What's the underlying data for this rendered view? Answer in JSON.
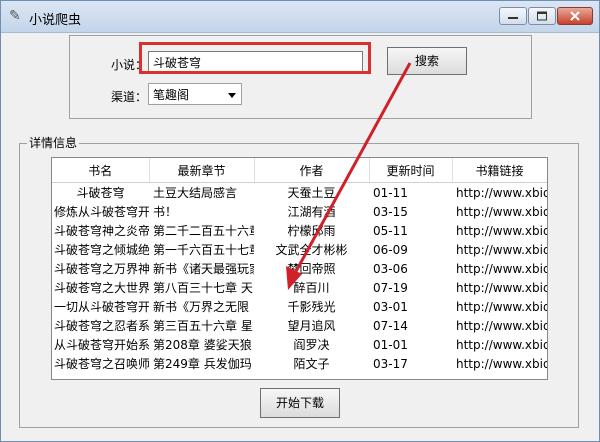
{
  "window": {
    "title": "小说爬虫"
  },
  "search": {
    "label": "小说：",
    "value": "斗破苍穹",
    "button": "搜索"
  },
  "channel": {
    "label": "渠道：",
    "selected": "笔趣阁"
  },
  "details": {
    "group_label": "详情信息",
    "columns": [
      "书名",
      "最新章节",
      "作者",
      "更新时间",
      "书籍链接"
    ],
    "rows": [
      [
        "斗破苍穹",
        "土豆大结局感言",
        "天蚕土豆",
        "01-11",
        "http://www.xbiqu"
      ],
      [
        "修炼从斗破苍穹开始",
        "书！",
        "江湖有酒",
        "03-15",
        "http://www.xbiqu"
      ],
      [
        "斗破苍穹神之炎帝",
        "第二千二百五十六章",
        "柠檬邱雨",
        "05-11",
        "http://www.xbiqu"
      ],
      [
        "斗破苍穹之倾城绝色",
        "第一千六百五十七章",
        "文武全才彬彬",
        "06-09",
        "http://www.xbiqu"
      ],
      [
        "斗破苍穹之万界神",
        "新书《诸天最强玩家",
        "梦回帝照",
        "03-06",
        "http://www.xbiqu"
      ],
      [
        "斗破苍穹之大世界",
        "第八百三十七章 天",
        "醉百川",
        "07-19",
        "http://www.xbiqu"
      ],
      [
        "一切从斗破苍穹开始",
        "新书《万界之无限",
        "千影残光",
        "03-01",
        "http://www.xbiqu"
      ],
      [
        "斗破苍穹之忍者系统",
        "第三百五十六章 星",
        "望月追风",
        "07-14",
        "http://www.xbiqu"
      ],
      [
        "从斗破苍穹开始系统",
        "第208章 婆娑天狼",
        "阎罗决",
        "01-01",
        "http://www.xbiqu"
      ],
      [
        "斗破苍穹之召唤师",
        "第249章 兵发伽玛",
        "陌文子",
        "03-17",
        "http://www.xbiqu"
      ]
    ]
  },
  "actions": {
    "start_download": "开始下载"
  },
  "colors": {
    "highlight": "#d93030",
    "arrow": "#d0202a"
  },
  "icons": {
    "app": "feather-icon",
    "minimize": "minimize-icon",
    "maximize": "maximize-icon",
    "close": "close-icon",
    "dropdown": "chevron-down-icon"
  }
}
